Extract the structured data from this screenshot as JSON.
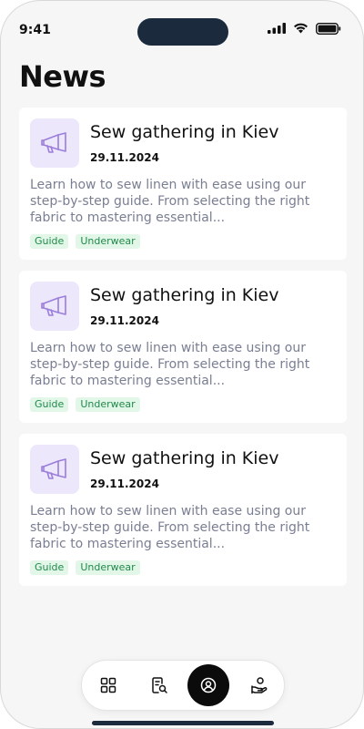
{
  "status_bar": {
    "time": "9:41"
  },
  "page": {
    "title": "News"
  },
  "news": [
    {
      "title": "Sew gathering in Kiev",
      "date": "29.11.2024",
      "description": "Learn how to sew linen with ease using our step-by-step guide. From selecting the right fabric to mastering essential...",
      "tags": [
        "Guide",
        "Underwear"
      ],
      "icon": "megaphone-icon"
    },
    {
      "title": "Sew gathering in Kiev",
      "date": "29.11.2024",
      "description": "Learn how to sew linen with ease using our step-by-step guide. From selecting the right fabric to mastering essential...",
      "tags": [
        "Guide",
        "Underwear"
      ],
      "icon": "megaphone-icon"
    },
    {
      "title": "Sew gathering in Kiev",
      "date": "29.11.2024",
      "description": "Learn how to sew linen with ease using our step-by-step guide. From selecting the right fabric to mastering essential...",
      "tags": [
        "Guide",
        "Underwear"
      ],
      "icon": "megaphone-icon"
    }
  ],
  "bottom_nav": {
    "items": [
      {
        "icon": "grid-icon",
        "active": false
      },
      {
        "icon": "document-search-icon",
        "active": false
      },
      {
        "icon": "user-circle-icon",
        "active": true
      },
      {
        "icon": "hand-coin-icon",
        "active": false
      }
    ]
  },
  "colors": {
    "accent_purple": "#9b7ddb",
    "icon_bg": "#ece7fb",
    "tag_text": "#1f8a4a",
    "tag_bg": "#e3f7e9",
    "nav_active": "#0b0b0b"
  }
}
